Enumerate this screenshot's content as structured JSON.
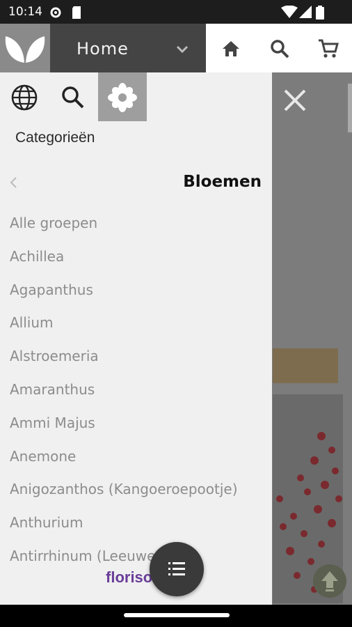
{
  "status_bar": {
    "time": "10:14",
    "icons": [
      "settings-icon",
      "sdcard-icon",
      "wifi-icon",
      "signal-icon",
      "battery-icon"
    ]
  },
  "app_bar": {
    "title": "Home",
    "actions": [
      "home-icon",
      "search-icon",
      "cart-icon"
    ]
  },
  "drawer": {
    "tools": [
      "globe-icon",
      "search-icon",
      "flower-icon"
    ],
    "section_label": "Categorieën",
    "category_title": "Bloemen",
    "items": [
      "Alle groepen",
      "Achillea",
      "Agapanthus",
      "Allium",
      "Alstroemeria",
      "Amaranthus",
      "Ammi Majus",
      "Anemone",
      "Anigozanthos (Kangoeroepootje)",
      "Anthurium",
      "Antirrhinum (Leeuwe"
    ],
    "brand_text": "floriso"
  },
  "colors": {
    "app_bar": "#444444",
    "drawer": "#f0f0f0",
    "active_tool": "#9e9e9e",
    "item_text": "#8c8c8c",
    "brand": "#6a3d9a"
  }
}
